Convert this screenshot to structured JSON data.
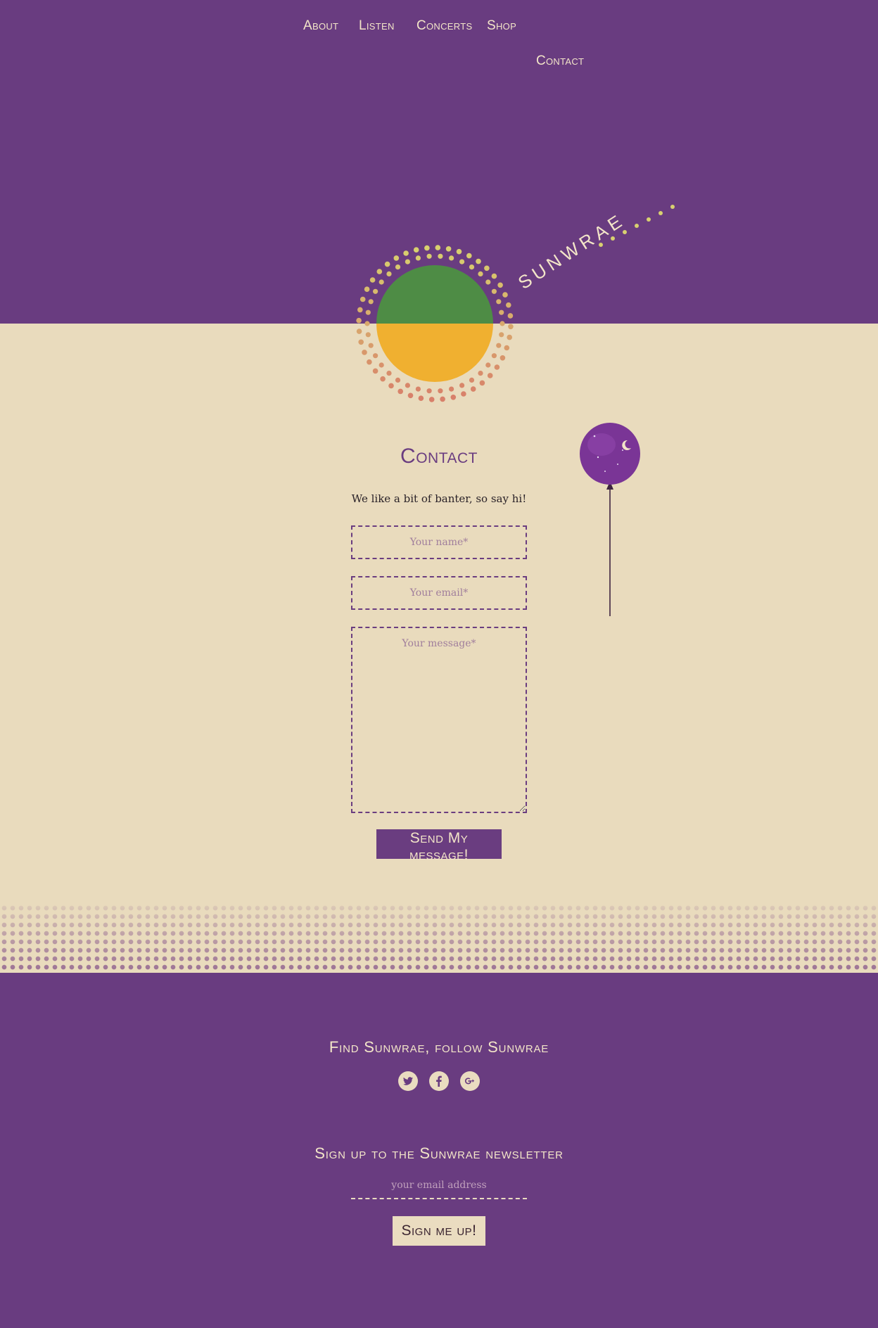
{
  "nav": {
    "about": "About",
    "listen": "Listen",
    "concerts": "Concerts",
    "shop": "Shop",
    "contact": "Contact"
  },
  "logo": {
    "text": "SUNWRAE"
  },
  "contact": {
    "title": "Contact",
    "intro": "We like a bit of banter, so say hi!",
    "name_placeholder": "Your name*",
    "email_placeholder": "Your email*",
    "message_placeholder": "Your message*",
    "send_label": "Send My message!"
  },
  "footer": {
    "follow_heading": "Find Sunwrae, follow Sunwrae",
    "social": [
      "twitter-icon",
      "facebook-icon",
      "google-plus-icon"
    ],
    "newsletter_heading": "Sign up to the Sunwrae newsletter",
    "email_placeholder": "your email address",
    "signup_label": "Sign me up!"
  },
  "colors": {
    "purple": "#693c80",
    "cream": "#e9dbbd",
    "sun_green": "#4e8c45",
    "sun_yellow": "#f0b030",
    "dot_coral": "#d9806a"
  }
}
